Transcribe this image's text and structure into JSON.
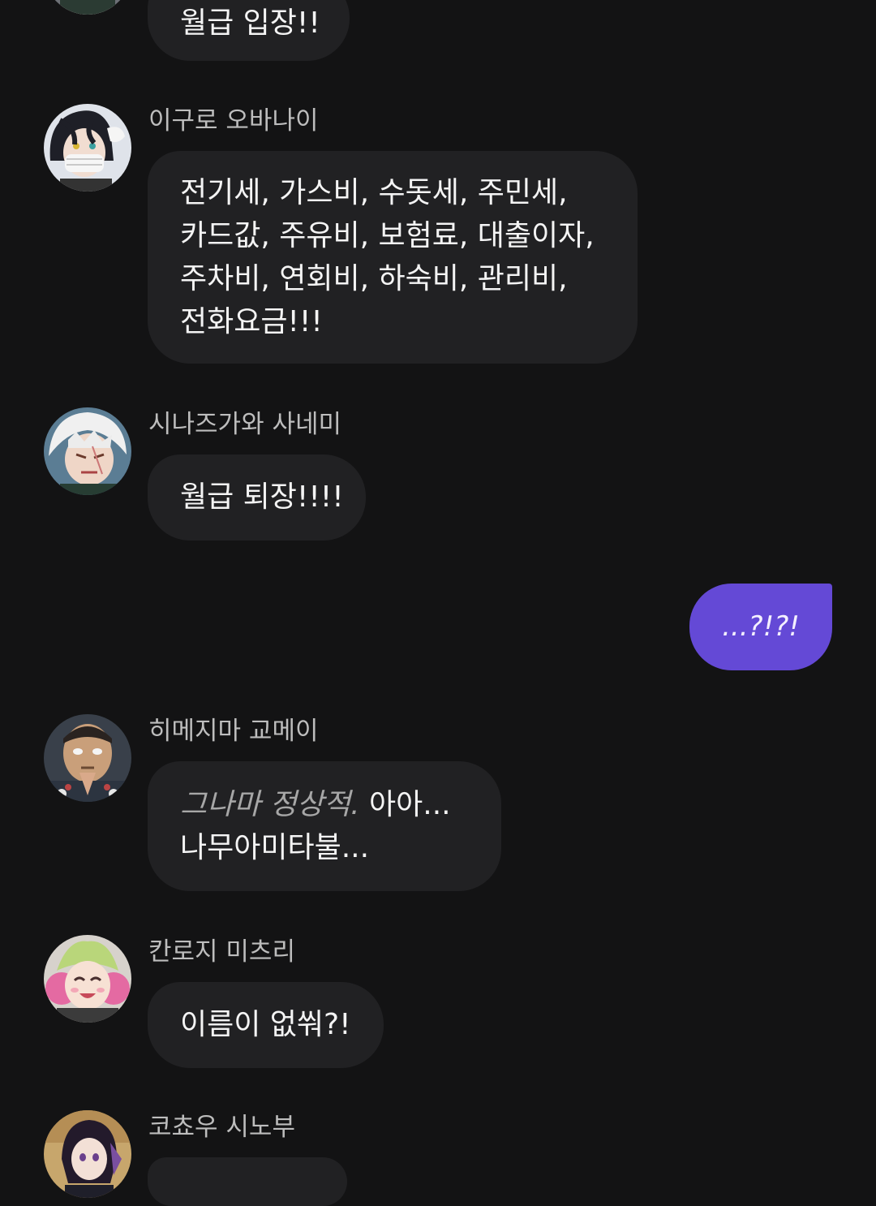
{
  "messages": [
    {
      "sender": "",
      "lines": [
        "월급 입장!!"
      ]
    },
    {
      "sender": "이구로 오바나이",
      "lines": [
        "전기세, 가스비, 수돗세, 주민세,",
        "카드값, 주유비, 보험료, 대출이자,",
        "주차비, 연회비, 하숙비, 관리비,",
        "전화요금!!!"
      ]
    },
    {
      "sender": "시나즈가와 사네미",
      "lines": [
        "월급 퇴장!!!!"
      ]
    },
    {
      "sender": "me",
      "text": "...?!?!"
    },
    {
      "sender": "히메지마 교메이",
      "italic_prefix": "그나마 정상적.",
      "line1_rest": " 아아...",
      "line2": "나무아미타불..."
    },
    {
      "sender": "칸로지 미츠리",
      "lines": [
        "이름이 없쒀?!"
      ]
    },
    {
      "sender": "코쵸우 시노부",
      "lines": []
    }
  ],
  "icons": {
    "avatar": "avatar-icon"
  },
  "colors": {
    "background": "#131314",
    "bubble": "#212123",
    "my_bubble": "#6449d6",
    "name": "#bdbdbd"
  }
}
